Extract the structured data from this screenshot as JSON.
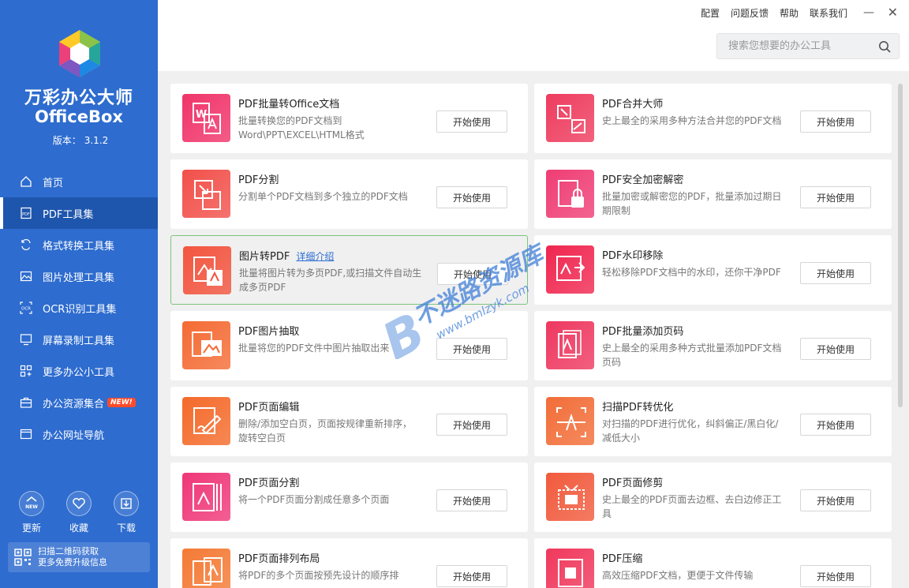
{
  "app": {
    "name_cn": "万彩办公大师",
    "name_en": "OfficeBox",
    "version_label": "版本：",
    "version": "3.1.2"
  },
  "topbar": {
    "links": [
      "配置",
      "问题反馈",
      "帮助",
      "联系我们"
    ],
    "minimize": "—",
    "close": "✕"
  },
  "search": {
    "placeholder": "搜索您想要的办公工具",
    "value": ""
  },
  "nav": [
    {
      "label": "首页",
      "icon": "home-icon"
    },
    {
      "label": "PDF工具集",
      "icon": "pdf-icon",
      "active": true
    },
    {
      "label": "格式转换工具集",
      "icon": "convert-icon"
    },
    {
      "label": "图片处理工具集",
      "icon": "image-icon"
    },
    {
      "label": "OCR识别工具集",
      "icon": "ocr-icon"
    },
    {
      "label": "屏幕录制工具集",
      "icon": "screen-record-icon"
    },
    {
      "label": "更多办公小工具",
      "icon": "grid-icon"
    },
    {
      "label": "办公资源集合",
      "icon": "briefcase-icon",
      "badge": "NEW!"
    },
    {
      "label": "办公网址导航",
      "icon": "browser-icon"
    }
  ],
  "bottom_buttons": [
    {
      "label": "更新",
      "icon": "update-new-icon",
      "icon_text": "NEW"
    },
    {
      "label": "收藏",
      "icon": "heart-icon"
    },
    {
      "label": "下载",
      "icon": "download-icon"
    }
  ],
  "qr": {
    "line1": "扫描二维码获取",
    "line2": "更多免费升级信息"
  },
  "button_label": "开始使用",
  "detail_link": "详细介绍",
  "tools": [
    {
      "title": "PDF批量转Office文档",
      "desc": "批量转换您的PDF文档到Word\\PPT\\EXCEL\\HTML格式",
      "color": "#f0346a",
      "icon": "pdf-to-office-icon"
    },
    {
      "title": "PDF合并大师",
      "desc": "史上最全的采用多种方法合并您的PDF文档",
      "color": "#ee3c5e",
      "icon": "pdf-merge-icon"
    },
    {
      "title": "PDF分割",
      "desc": "分割单个PDF文档到多个独立的PDF文档",
      "color": "#f2504a",
      "icon": "pdf-split-icon"
    },
    {
      "title": "PDF安全加密解密",
      "desc": "批量加密或解密您的PDF，批量添加过期日期限制",
      "color": "#ef3d74",
      "icon": "pdf-lock-icon"
    },
    {
      "title": "图片转PDF",
      "desc": "批量将图片转为多页PDF,或扫描文件自动生成多页PDF",
      "color": "#f3553f",
      "icon": "image-to-pdf-icon",
      "has_link": true
    },
    {
      "title": "PDF水印移除",
      "desc": "轻松移除PDF文档中的水印，还你干净PDF",
      "color": "#f0264f",
      "icon": "pdf-watermark-remove-icon"
    },
    {
      "title": "PDF图片抽取",
      "desc": "批量将您的PDF文件中图片抽取出来",
      "color": "#f46b34",
      "icon": "pdf-image-extract-icon"
    },
    {
      "title": "PDF批量添加页码",
      "desc": "史上最全的采用多种方式批量添加PDF文档页码",
      "color": "#ee3860",
      "icon": "pdf-page-number-icon"
    },
    {
      "title": "PDF页面编辑",
      "desc": "删除/添加空白页，页面按规律重新排序，旋转空白页",
      "color": "#f46a2a",
      "icon": "pdf-page-edit-icon"
    },
    {
      "title": "扫描PDF转优化",
      "desc": "对扫描的PDF进行优化，纠斜偏正/黑白化/减低大小",
      "color": "#f26d38",
      "icon": "scan-optimize-icon"
    },
    {
      "title": "PDF页面分割",
      "desc": "将一个PDF页面分割成任意多个页面",
      "color": "#ef3778",
      "icon": "pdf-page-split-icon"
    },
    {
      "title": "PDF页面修剪",
      "desc": "史上最全的PDF页面去边框、去白边修正工具",
      "color": "#f15a3c",
      "icon": "pdf-crop-icon"
    },
    {
      "title": "PDF页面排列布局",
      "desc": "将PDF的多个页面按预先设计的顺序排",
      "color": "#f47a35",
      "icon": "pdf-layout-icon"
    },
    {
      "title": "PDF压缩",
      "desc": "高效压缩PDF文档，更便于文件传输",
      "color": "#f0385c",
      "icon": "pdf-compress-icon"
    }
  ],
  "watermark": {
    "text1": "不迷路资源库",
    "text2": "www.bmlzyk.com"
  }
}
